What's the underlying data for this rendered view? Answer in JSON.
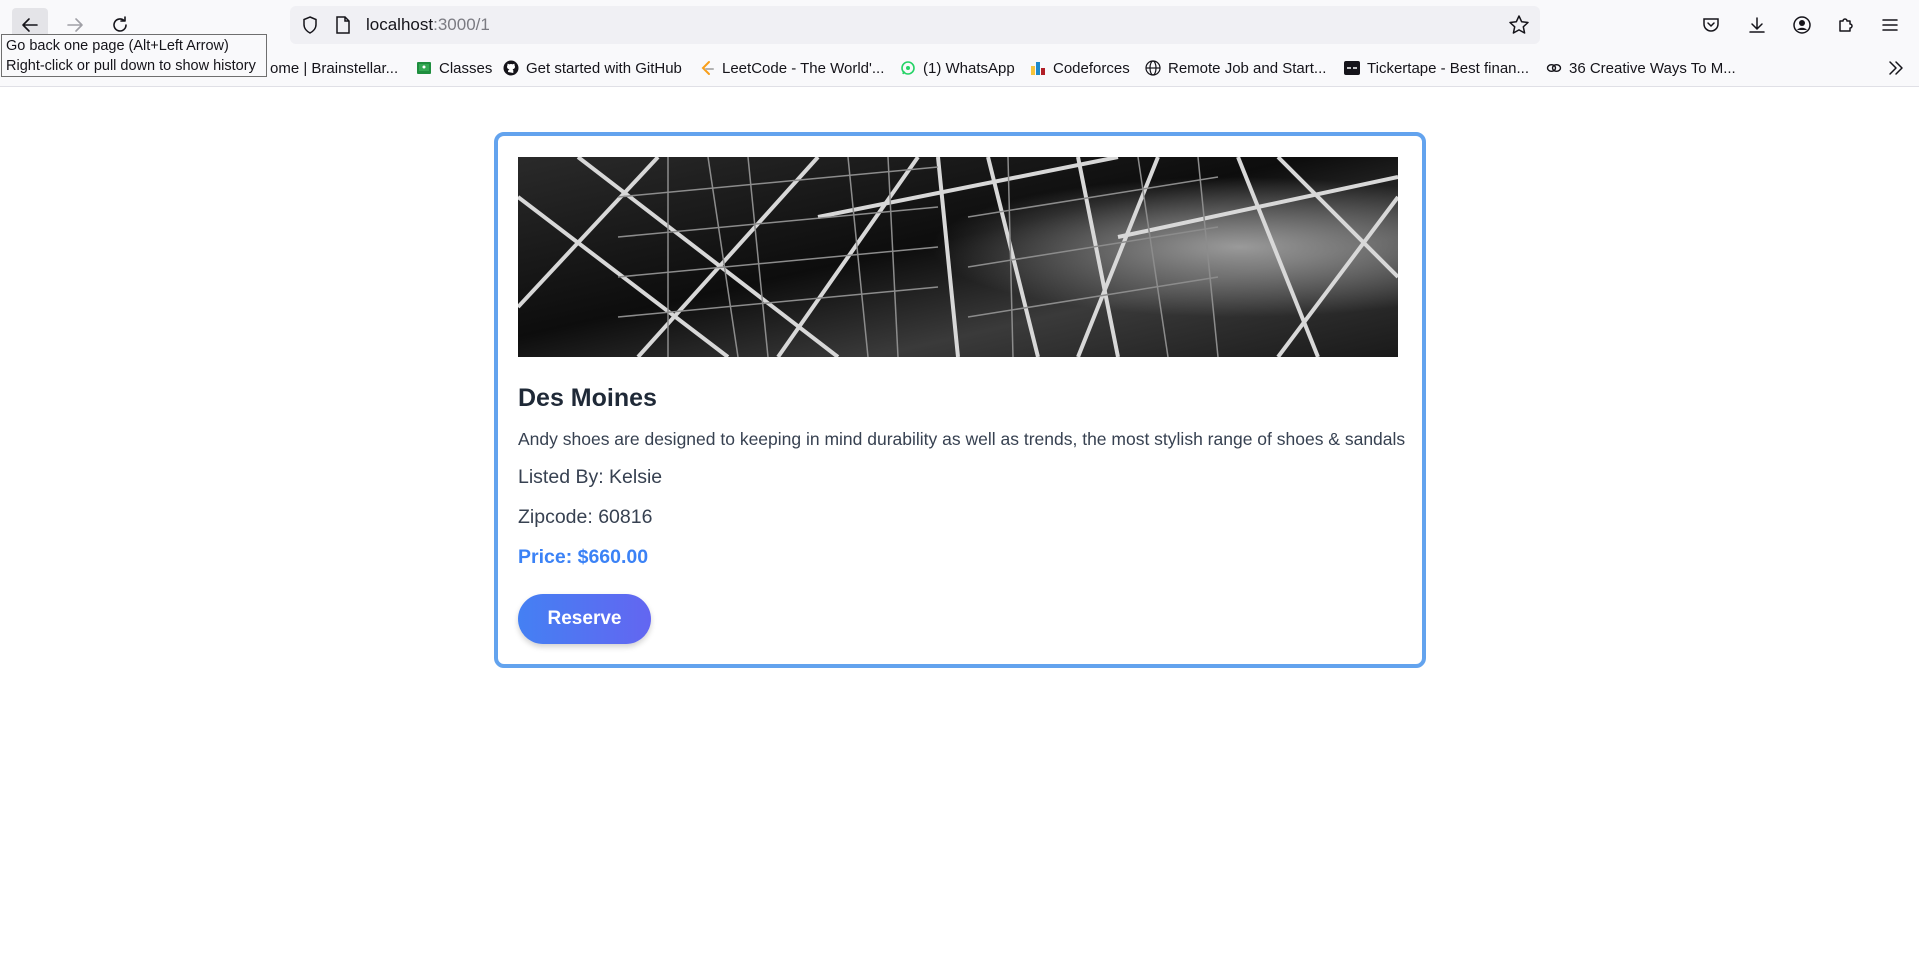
{
  "browser": {
    "url_host": "localhost",
    "url_path": ":3000/1",
    "tooltip": {
      "line1": "Go back one page (Alt+Left Arrow)",
      "line2": "Right-click or pull down to show history"
    },
    "bookmarks": [
      {
        "label": "ome | Brainstellar...",
        "icon": "brainstellar-icon"
      },
      {
        "label": "Classes",
        "icon": "google-classroom-icon"
      },
      {
        "label": "Get started with GitHub",
        "icon": "github-icon"
      },
      {
        "label": "LeetCode - The World'...",
        "icon": "leetcode-icon"
      },
      {
        "label": "(1) WhatsApp",
        "icon": "whatsapp-icon"
      },
      {
        "label": "Codeforces",
        "icon": "codeforces-icon"
      },
      {
        "label": "Remote Job and Start...",
        "icon": "globe-icon"
      },
      {
        "label": "Tickertape - Best finan...",
        "icon": "tickertape-icon"
      },
      {
        "label": "36 Creative Ways To M...",
        "icon": "link-icon"
      }
    ]
  },
  "listing": {
    "title": "Des Moines",
    "description": "Andy shoes are designed to keeping in mind durability as well as trends, the most stylish range of shoes & sandals",
    "listed_by": "Listed By: Kelsie",
    "zipcode": "Zipcode: 60816",
    "price": "Price: $660.00",
    "reserve_label": "Reserve"
  },
  "colors": {
    "card_border": "#63a3ee",
    "price": "#3b82f6",
    "button_start": "#4480f3",
    "button_end": "#6366f1"
  }
}
